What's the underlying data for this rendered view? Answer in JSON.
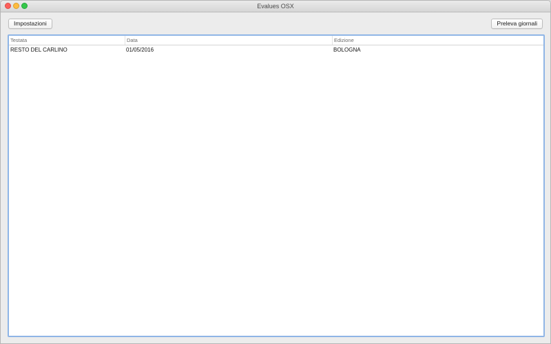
{
  "window": {
    "title": "Evalues OSX"
  },
  "toolbar": {
    "settings_label": "Impostazioni",
    "fetch_label": "Preleva giornali"
  },
  "table": {
    "columns": [
      "Testata",
      "Data",
      "Edizione"
    ],
    "rows": [
      [
        "RESTO DEL CARLINO",
        "01/05/2016",
        "BOLOGNA"
      ]
    ]
  },
  "colors": {
    "focus_ring": "#8fb5e6",
    "close": "#fc605c",
    "minimize": "#fdbc40",
    "maximize": "#34c84a"
  }
}
